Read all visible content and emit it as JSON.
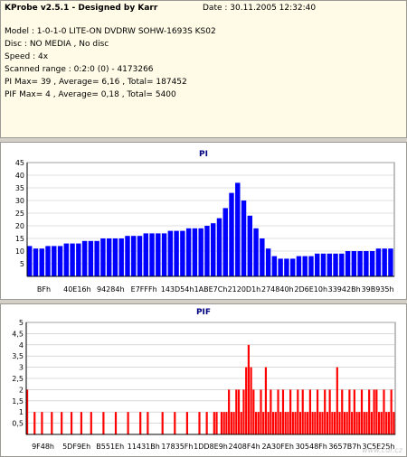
{
  "header": {
    "title": "KProbe v2.5.1 - Designed by Karr",
    "date": "Date : 30.11.2005 12:32:40",
    "model": "Model : 1-0-1-0 LITE-ON DVDRW SOHW-1693S KS02",
    "disc": "Disc : NO MEDIA , No disc",
    "speed": "Speed : 4x",
    "range": "Scanned range : 0:2:0 (0) - 4173266",
    "pi_stats": "PI Max= 39 , Average= 6,16 , Total= 187452",
    "pif_stats": "PIF Max= 4 , Average= 0,18 , Total= 5400"
  },
  "watermark": "www.cdr.cz",
  "chart_data": [
    {
      "type": "bar",
      "title": "PI",
      "color": "#0000ff",
      "ylim": [
        0,
        45
      ],
      "yticks": [
        "45",
        "40",
        "35",
        "30",
        "25",
        "20",
        "15",
        "10",
        "5"
      ],
      "xticks": [
        "BFh",
        "40E16h",
        "94284h",
        "E7FFFh",
        "143D54h",
        "1ABE7Ch",
        "2120D1h",
        "274840h",
        "2D6E10h",
        "33942Bh",
        "39B935h"
      ],
      "series": [
        {
          "values": [
            12,
            11,
            11,
            12,
            12,
            12,
            13,
            13,
            13,
            14,
            14,
            14,
            15,
            15,
            15,
            15,
            16,
            16,
            16,
            17,
            17,
            17,
            17,
            18,
            18,
            18,
            19,
            19,
            19,
            20,
            21,
            23,
            27,
            33,
            37,
            30,
            24,
            19,
            15,
            11,
            8,
            7,
            7,
            7,
            8,
            8,
            8,
            9,
            9,
            9,
            9,
            9,
            10,
            10,
            10,
            10,
            10,
            11,
            11,
            11
          ]
        }
      ]
    },
    {
      "type": "bar",
      "title": "PIF",
      "color": "#ff0000",
      "ylim": [
        0,
        5
      ],
      "yticks": [
        "5",
        "4,5",
        "4",
        "3,5",
        "3",
        "2,5",
        "2",
        "1,5",
        "1",
        "0,5"
      ],
      "xticks": [
        "9F48h",
        "5DF9Eh",
        "B551Eh",
        "11431Bh",
        "17835Fh",
        "1DD8E9h",
        "2408F4h",
        "2A30FEh",
        "30548Fh",
        "3657B7h",
        "3C5E25h"
      ],
      "series": [
        {
          "values": [
            2,
            0,
            0,
            1,
            0,
            0,
            1,
            0,
            0,
            0,
            1,
            0,
            0,
            0,
            1,
            0,
            0,
            0,
            1,
            0,
            0,
            0,
            1,
            0,
            0,
            0,
            1,
            0,
            0,
            0,
            0,
            1,
            0,
            0,
            0,
            0,
            1,
            0,
            0,
            0,
            0,
            1,
            0,
            0,
            0,
            0,
            1,
            0,
            0,
            1,
            0,
            0,
            0,
            0,
            0,
            1,
            0,
            0,
            0,
            0,
            1,
            0,
            0,
            0,
            0,
            1,
            0,
            0,
            0,
            0,
            1,
            0,
            0,
            1,
            0,
            0,
            1,
            1,
            0,
            1,
            1,
            1,
            2,
            1,
            1,
            2,
            2,
            1,
            2,
            3,
            4,
            3,
            2,
            1,
            1,
            2,
            1,
            3,
            1,
            2,
            1,
            1,
            2,
            1,
            2,
            1,
            1,
            2,
            1,
            1,
            2,
            1,
            2,
            1,
            1,
            2,
            1,
            1,
            2,
            1,
            1,
            2,
            1,
            2,
            1,
            1,
            3,
            1,
            2,
            1,
            1,
            2,
            1,
            2,
            1,
            1,
            2,
            1,
            1,
            2,
            1,
            2,
            2,
            1,
            1,
            2,
            1,
            1,
            2,
            1
          ]
        }
      ]
    }
  ]
}
